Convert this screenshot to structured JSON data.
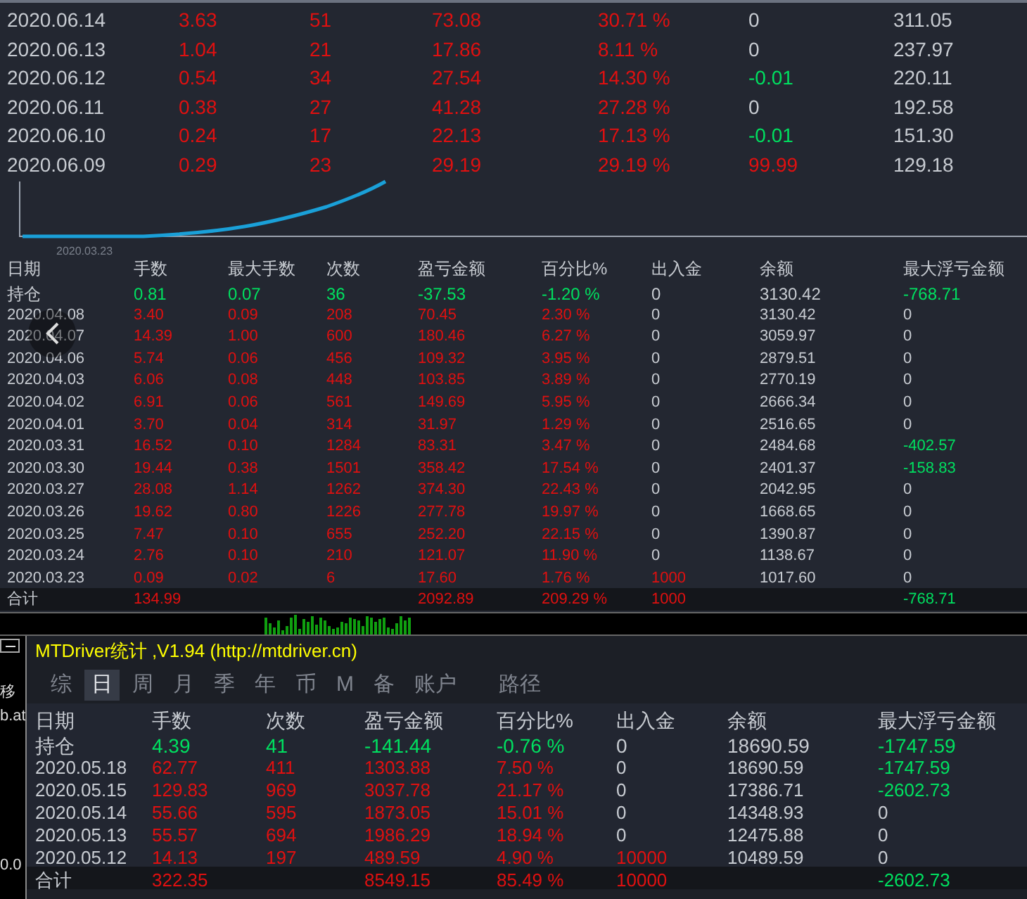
{
  "recent_table": {
    "rows": [
      [
        "2020.06.14",
        "3.63",
        "51",
        "73.08",
        "30.71 %",
        "0",
        "311.05"
      ],
      [
        "2020.06.13",
        "1.04",
        "21",
        "17.86",
        "8.11 %",
        "0",
        "237.97"
      ],
      [
        "2020.06.12",
        "0.54",
        "34",
        "27.54",
        "14.30 %",
        "-0.01",
        "220.11"
      ],
      [
        "2020.06.11",
        "0.38",
        "27",
        "41.28",
        "27.28 %",
        "0",
        "192.58"
      ],
      [
        "2020.06.10",
        "0.24",
        "17",
        "22.13",
        "17.13 %",
        "-0.01",
        "151.30"
      ],
      [
        "2020.06.09",
        "0.29",
        "23",
        "29.19",
        "29.19 %",
        "99.99",
        "129.18"
      ]
    ]
  },
  "equity_curve": {
    "start_label": "2020.03.23"
  },
  "daily_table": {
    "columns": [
      "日期",
      "手数",
      "最大手数",
      "次数",
      "盈亏金额",
      "百分比%",
      "出入金",
      "余额",
      "最大浮亏金额"
    ],
    "position_row": [
      "持仓",
      "0.81",
      "0.07",
      "36",
      "-37.53",
      "-1.20 %",
      "0",
      "3130.42",
      "-768.71"
    ],
    "rows": [
      [
        "2020.04.08",
        "3.40",
        "0.09",
        "208",
        "70.45",
        "2.30 %",
        "0",
        "3130.42",
        "0"
      ],
      [
        "2020.04.07",
        "14.39",
        "1.00",
        "600",
        "180.46",
        "6.27 %",
        "0",
        "3059.97",
        "0"
      ],
      [
        "2020.04.06",
        "5.74",
        "0.06",
        "456",
        "109.32",
        "3.95 %",
        "0",
        "2879.51",
        "0"
      ],
      [
        "2020.04.03",
        "6.06",
        "0.08",
        "448",
        "103.85",
        "3.89 %",
        "0",
        "2770.19",
        "0"
      ],
      [
        "2020.04.02",
        "6.91",
        "0.06",
        "561",
        "149.69",
        "5.95 %",
        "0",
        "2666.34",
        "0"
      ],
      [
        "2020.04.01",
        "3.70",
        "0.04",
        "314",
        "31.97",
        "1.29 %",
        "0",
        "2516.65",
        "0"
      ],
      [
        "2020.03.31",
        "16.52",
        "0.10",
        "1284",
        "83.31",
        "3.47 %",
        "0",
        "2484.68",
        "-402.57"
      ],
      [
        "2020.03.30",
        "19.44",
        "0.38",
        "1501",
        "358.42",
        "17.54 %",
        "0",
        "2401.37",
        "-158.83"
      ],
      [
        "2020.03.27",
        "28.08",
        "1.14",
        "1262",
        "374.30",
        "22.43 %",
        "0",
        "2042.95",
        "0"
      ],
      [
        "2020.03.26",
        "19.62",
        "0.80",
        "1226",
        "277.78",
        "19.97 %",
        "0",
        "1668.65",
        "0"
      ],
      [
        "2020.03.25",
        "7.47",
        "0.10",
        "655",
        "252.20",
        "22.15 %",
        "0",
        "1390.87",
        "0"
      ],
      [
        "2020.03.24",
        "2.76",
        "0.10",
        "210",
        "121.07",
        "11.90 %",
        "0",
        "1138.67",
        "0"
      ],
      [
        "2020.03.23",
        "0.09",
        "0.02",
        "6",
        "17.60",
        "1.76 %",
        "1000",
        "1017.60",
        "0"
      ]
    ],
    "total_row": {
      "label": "合计",
      "lots": "134.99",
      "pnl": "2092.89",
      "percent": "209.29 %",
      "deposit": "1000",
      "max_float_loss": "-768.71"
    }
  },
  "side_strip": {
    "texts": [
      "移",
      "b.at",
      "0.0"
    ]
  },
  "panel": {
    "title": "MTDriver统计 ,V1.94 (http://mtdriver.cn)",
    "tabs": [
      {
        "label": "综",
        "selected": false
      },
      {
        "label": "日",
        "selected": true
      },
      {
        "label": "周",
        "selected": false
      },
      {
        "label": "月",
        "selected": false
      },
      {
        "label": "季",
        "selected": false
      },
      {
        "label": "年",
        "selected": false
      },
      {
        "label": "币",
        "selected": false
      },
      {
        "label": "M",
        "selected": false
      },
      {
        "label": "备",
        "selected": false
      },
      {
        "label": "账户",
        "selected": false
      },
      {
        "label": "路径",
        "selected": false
      }
    ],
    "columns": [
      "日期",
      "手数",
      "次数",
      "盈亏金额",
      "百分比%",
      "出入金",
      "余额",
      "最大浮亏金额"
    ],
    "position_row": [
      "持仓",
      "4.39",
      "41",
      "-141.44",
      "-0.76 %",
      "0",
      "18690.59",
      "-1747.59"
    ],
    "rows": [
      [
        "2020.05.18",
        "62.77",
        "411",
        "1303.88",
        "7.50 %",
        "0",
        "18690.59",
        "-1747.59"
      ],
      [
        "2020.05.15",
        "129.83",
        "969",
        "3037.78",
        "21.17 %",
        "0",
        "17386.71",
        "-2602.73"
      ],
      [
        "2020.05.14",
        "55.66",
        "595",
        "1873.05",
        "15.01 %",
        "0",
        "14348.93",
        "0"
      ],
      [
        "2020.05.13",
        "55.57",
        "694",
        "1986.29",
        "18.94 %",
        "0",
        "12475.88",
        "0"
      ],
      [
        "2020.05.12",
        "14.13",
        "197",
        "489.59",
        "4.90 %",
        "10000",
        "10489.59",
        "0"
      ]
    ],
    "total_row": {
      "label": "合计",
      "lots": "322.35",
      "pnl": "8549.15",
      "percent": "85.49 %",
      "deposit": "10000",
      "max_float_loss": "-2602.73"
    }
  }
}
